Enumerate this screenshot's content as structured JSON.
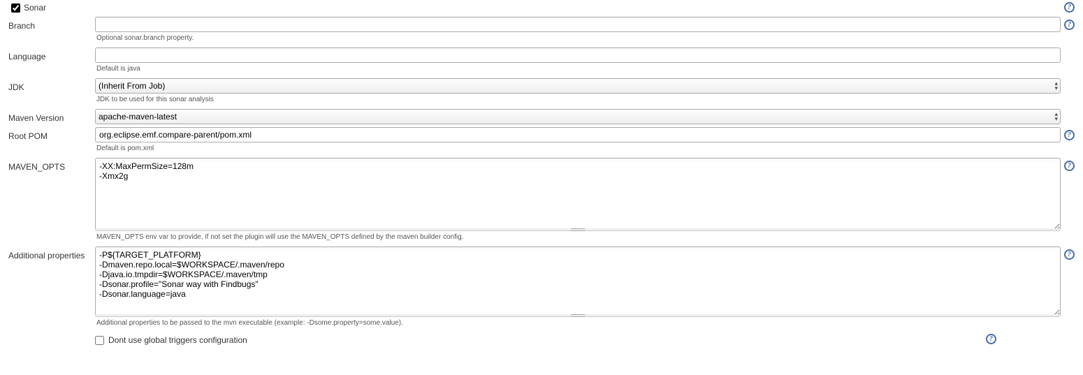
{
  "section": {
    "title": "Sonar",
    "checked": true
  },
  "fields": {
    "branch": {
      "label": "Branch",
      "value": "",
      "hint": "Optional sonar.branch property."
    },
    "language": {
      "label": "Language",
      "value": "",
      "hint": "Default is java"
    },
    "jdk": {
      "label": "JDK",
      "selected": "(Inherit From Job)",
      "hint": "JDK to be used for this sonar analysis"
    },
    "mavenVersion": {
      "label": "Maven Version",
      "selected": "apache-maven-latest"
    },
    "rootPom": {
      "label": "Root POM",
      "value": "org.eclipse.emf.compare-parent/pom.xml",
      "hint": "Default is pom.xml"
    },
    "mavenOpts": {
      "label": "MAVEN_OPTS",
      "value": "-XX:MaxPermSize=128m\n-Xmx2g",
      "hint": "MAVEN_OPTS env var to provide, if not set the plugin will use the MAVEN_OPTS defined by the maven builder config."
    },
    "additionalProps": {
      "label": "Additional properties",
      "value": "-P${TARGET_PLATFORM}\n-Dmaven.repo.local=$WORKSPACE/.maven/repo\n-Djava.io.tmpdir=$WORKSPACE/.maven/tmp\n-Dsonar.profile=\"Sonar way with Findbugs\"\n-Dsonar.language=java",
      "hint": "Additional properties to be passed to the mvn executable (example: -Dsome.property=some.value)."
    },
    "globalTriggers": {
      "label": "Dont use global triggers configuration",
      "checked": false
    }
  }
}
